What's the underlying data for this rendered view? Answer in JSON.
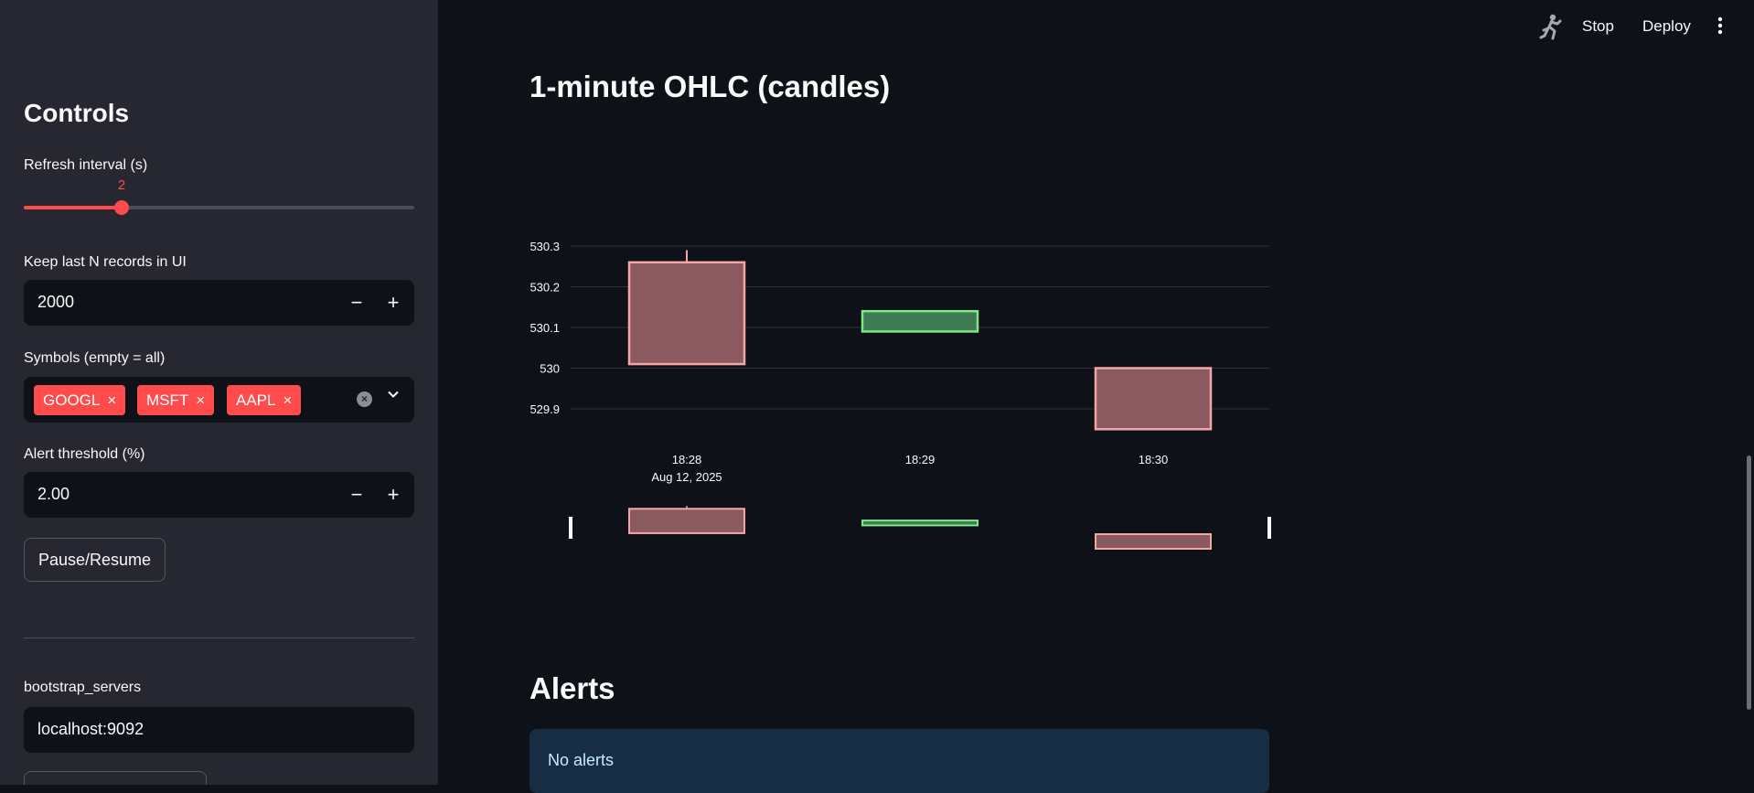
{
  "sidebar": {
    "title": "Controls",
    "refresh": {
      "label": "Refresh interval (s)",
      "value": "2",
      "min": 1,
      "max": 10,
      "fraction": 0.25
    },
    "keep_last": {
      "label": "Keep last N records in UI",
      "value": "2000",
      "minus": "−",
      "plus": "+"
    },
    "symbols": {
      "label": "Symbols (empty = all)",
      "chips": [
        "GOOGL",
        "MSFT",
        "AAPL"
      ],
      "chip_close": "×",
      "clear": "×"
    },
    "alert": {
      "label": "Alert threshold (%)",
      "value": "2.00",
      "minus": "−",
      "plus": "+"
    },
    "pause_button": "Pause/Resume",
    "bootstrap": {
      "label": "bootstrap_servers",
      "value": "localhost:9092"
    }
  },
  "toolbar": {
    "stop": "Stop",
    "deploy": "Deploy"
  },
  "main": {
    "chart_heading": "1-minute OHLC (candles)",
    "alerts_heading": "Alerts",
    "alerts_text": "No alerts"
  },
  "colors": {
    "accent": "#ff4b4b",
    "up": "#7ee787",
    "down": "#f4a5a5",
    "sidebar": "#262730",
    "background": "#0e1117"
  },
  "chart_data": {
    "type": "candlestick",
    "title": "",
    "xlabel": "",
    "ylabel": "",
    "x": [
      "18:28",
      "18:29",
      "18:30"
    ],
    "x_sublabel": "Aug 12, 2025",
    "ylim": [
      529.85,
      530.3
    ],
    "yticks": [
      "530.3",
      "530.2",
      "530.1",
      "530",
      "529.9"
    ],
    "ytick_values": [
      530.3,
      530.2,
      530.1,
      530.0,
      529.9
    ],
    "candles": [
      {
        "time": "18:28",
        "open": 530.26,
        "high": 530.29,
        "low": 530.01,
        "close": 530.01,
        "direction": "down"
      },
      {
        "time": "18:29",
        "open": 530.09,
        "high": 530.14,
        "low": 530.09,
        "close": 530.14,
        "direction": "up"
      },
      {
        "time": "18:30",
        "open": 530.0,
        "high": 530.0,
        "low": 529.85,
        "close": 529.85,
        "direction": "down"
      }
    ],
    "grid": true,
    "range_slider": true
  }
}
